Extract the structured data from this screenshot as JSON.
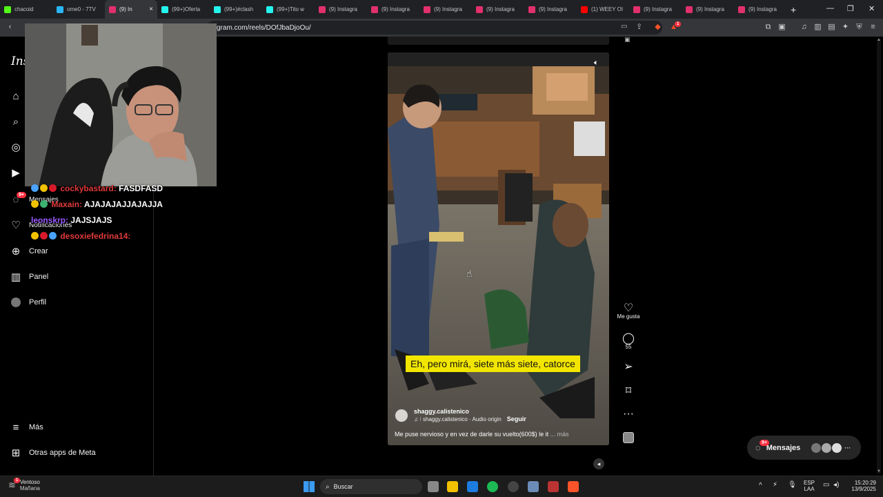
{
  "browser": {
    "tabs": [
      {
        "title": "chacoid",
        "color": "#53fc18"
      },
      {
        "title": "ome0 - 7TV",
        "color": "#29b6f6"
      },
      {
        "title": "(9) In",
        "color": "#e1306c",
        "active": true
      },
      {
        "title": "(99+)Oferta",
        "color": "#25f4ee"
      },
      {
        "title": "(99+)#clash",
        "color": "#25f4ee"
      },
      {
        "title": "(99+)Tito w",
        "color": "#25f4ee"
      },
      {
        "title": "(9) Instagra",
        "color": "#e1306c"
      },
      {
        "title": "(9) Instagra",
        "color": "#e1306c"
      },
      {
        "title": "(9) Instagra",
        "color": "#e1306c"
      },
      {
        "title": "(9) Instagra",
        "color": "#e1306c"
      },
      {
        "title": "(9) Instagra",
        "color": "#e1306c"
      },
      {
        "title": "(1) WEEY OI",
        "color": "#ff0000"
      },
      {
        "title": "(9) Instagra",
        "color": "#e1306c"
      },
      {
        "title": "(9) Instagra",
        "color": "#e1306c"
      },
      {
        "title": "(9) Instagra",
        "color": "#e1306c"
      }
    ],
    "new_tab": "+",
    "close_tab": "×",
    "url": "gram.com/reels/DOfJbaDjoOu/",
    "win_min": "—",
    "win_max": "❐",
    "win_close": "✕",
    "brave_badge": "1"
  },
  "sidebar": {
    "logo": "Ins",
    "items": [
      {
        "label": "",
        "icon": "home-icon"
      },
      {
        "label": "",
        "icon": "search-icon"
      },
      {
        "label": "",
        "icon": "explore-icon"
      },
      {
        "label": "",
        "icon": "reels-icon"
      },
      {
        "label": "Mensajes",
        "icon": "messenger-icon",
        "badge": "9+"
      },
      {
        "label": "Notificaciones",
        "icon": "heart-icon"
      },
      {
        "label": "Crear",
        "icon": "plus-icon"
      },
      {
        "label": "Panel",
        "icon": "chart-icon"
      },
      {
        "label": "Perfil",
        "icon": "avatar"
      }
    ],
    "more": "Más",
    "meta_apps": "Otras apps de Meta"
  },
  "chat": [
    {
      "user": "cockybastard:",
      "msg": "FASDFASD",
      "user_color": "#e03a3a"
    },
    {
      "user": "Maxain:",
      "msg": "AJAJAJAJJAJAJJA",
      "user_color": "#e03a3a"
    },
    {
      "user": "leonskrp:",
      "msg": "JAJSJAJS",
      "user_color": "#9b59ff"
    },
    {
      "user": "desoxiefedrina14:",
      "msg": "",
      "user_color": "#e03a3a"
    }
  ],
  "reel": {
    "caption": "Eh, pero mirá, siete más siete, catorce",
    "username": "shaggy.calistenico",
    "follow": "Seguir",
    "audio": "shaggy.calistenico · Audio origin",
    "description": "Me puse nervioso y en vez de darle su vuelto(600$) le it",
    "more": "... más",
    "likes_label": "Me gusta",
    "comments": "55"
  },
  "messages_pill": {
    "label": "Mensajes",
    "badge": "9+",
    "more": "···"
  },
  "taskbar": {
    "weather_title": "Ventoso",
    "weather_sub": "Mañana",
    "weather_badge": "1",
    "search": "Buscar",
    "lang": "ESP",
    "lang_sub": "LAA",
    "time": "15:20:29",
    "date": "13/9/2025"
  }
}
